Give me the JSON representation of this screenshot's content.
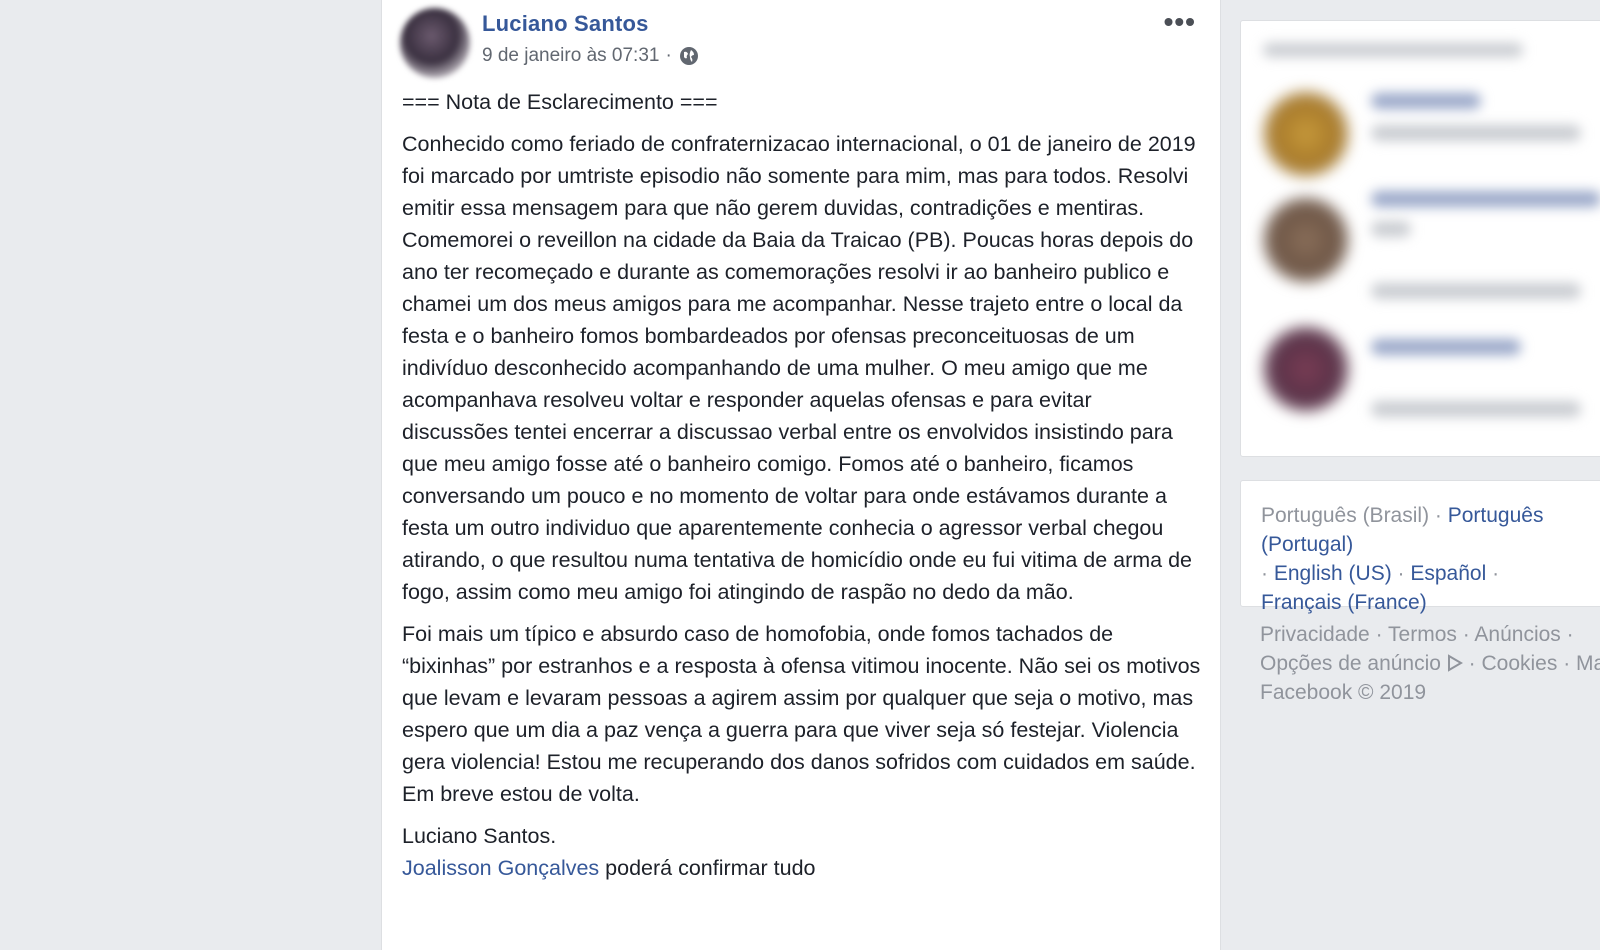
{
  "post": {
    "author": "Luciano Santos",
    "timestamp": "9 de janeiro às 07:31",
    "separator": "·",
    "more_label": "•••",
    "heading": "=== Nota de Esclarecimento ===",
    "paragraph1": "Conhecido como feriado de confraternizacao internacional, o 01 de janeiro de 2019 foi marcado por umtriste episodio não somente para mim, mas para todos. Resolvi emitir essa mensagem para que não gerem duvidas, contradições e mentiras. Comemorei o reveillon na cidade da Baia da Traicao (PB). Poucas horas depois do ano ter recomeçado e durante as comemorações resolvi ir ao banheiro publico e chamei um dos meus amigos para me acompanhar. Nesse trajeto entre o local da festa e o banheiro fomos bombardeados por ofensas preconceituosas de um indivíduo desconhecido acompanhando de uma mulher. O meu amigo que me acompanhava resolveu voltar e responder aquelas ofensas e para evitar discussões tentei encerrar a discussao verbal entre os envolvidos insistindo para que meu amigo fosse até o banheiro comigo. Fomos até o banheiro, ficamos conversando um pouco e no momento de voltar para onde estávamos durante a festa um outro individuo que aparentemente conhecia o agressor verbal chegou atirando, o que resultou numa tentativa de homicídio onde eu fui vitima de arma de fogo, assim como meu amigo foi atingindo de raspão no dedo da mão.",
    "paragraph2": "Foi mais um típico e absurdo caso de homofobia, onde fomos tachados de “bixinhas” por estranhos e a resposta à ofensa vitimou inocente. Não sei os motivos que levam e levaram pessoas a agirem assim por qualquer que seja o motivo, mas espero que um dia a paz vença a guerra para que viver seja só festejar. Violencia gera violencia! Estou me recuperando dos danos sofridos com cuidados em saúde. Em breve estou de volta.",
    "signature": "Luciano Santos.",
    "mention": "Joalisson Gonçalves",
    "closing": " poderá confirmar tudo"
  },
  "languages": {
    "current": "Português (Brasil)",
    "items": [
      "Português (Portugal)",
      "English (US)",
      "Español",
      "Français (France)"
    ],
    "sep": " · "
  },
  "footer": {
    "privacy": "Privacidade",
    "terms": "Termos",
    "ads": "Anúncios",
    "ad_choices": "Opções de anúncio",
    "cookies": "Cookies",
    "more": "Mais",
    "sep": " · ",
    "copyright": "Facebook © 2019"
  },
  "colors": {
    "link": "#365899",
    "page_bg": "#e9ebee",
    "muted": "#90949c"
  }
}
